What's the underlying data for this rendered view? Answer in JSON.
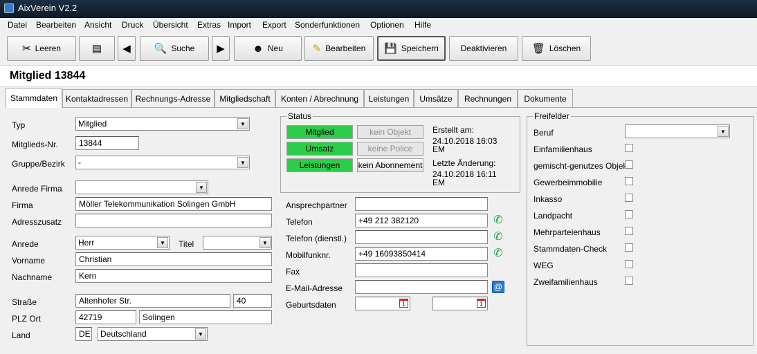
{
  "window": {
    "title": "AixVerein V2.2"
  },
  "menu": [
    "Datei",
    "Bearbeiten",
    "Ansicht",
    "Druck",
    "Übersicht",
    "Extras",
    "Import",
    "Export",
    "Sonderfunktionen",
    "Optionen",
    "Hilfe"
  ],
  "toolbar": {
    "leeren": "Leeren",
    "suche": "Suche",
    "neu": "Neu",
    "bearbeiten": "Bearbeiten",
    "speichern": "Speichern",
    "deaktivieren": "Deaktivieren",
    "loeschen": "Löschen"
  },
  "header": {
    "title": "Mitglied 13844"
  },
  "tabs": [
    "Stammdaten",
    "Kontaktadressen",
    "Rechnungs-Adresse",
    "Mitgliedschaft",
    "Konten / Abrechnung",
    "Leistungen",
    "Umsätze",
    "Rechnungen",
    "Dokumente"
  ],
  "form": {
    "typ_label": "Typ",
    "typ_value": "Mitglied",
    "nr_label": "Mitglieds-Nr.",
    "nr_value": "13844",
    "gruppe_label": "Gruppe/Bezirk",
    "gruppe_value": "-",
    "anrede_firma_label": "Anrede Firma",
    "anrede_firma_value": "",
    "firma_label": "Firma",
    "firma_value": "Möller Telekommunikation Solingen GmbH",
    "adresszusatz_label": "Adresszusatz",
    "adresszusatz_value": "",
    "anrede_label": "Anrede",
    "anrede_value": "Herr",
    "titel_label": "Titel",
    "titel_value": "",
    "vorname_label": "Vorname",
    "vorname_value": "Christian",
    "nachname_label": "Nachname",
    "nachname_value": "Kern",
    "strasse_label": "Straße",
    "strasse_value": "Altenhofer Str.",
    "hausnr_value": "40",
    "plz_label": "PLZ Ort",
    "plz_value": "42719",
    "ort_value": "Solingen",
    "land_label": "Land",
    "land_code": "DE",
    "land_value": "Deutschland"
  },
  "status": {
    "title": "Status",
    "btn_mitglied": "Mitglied",
    "btn_umsatz": "Umsatz",
    "btn_leistungen": "Leistungen",
    "btn_kein_objekt": "kein Objekt",
    "btn_keine_police": "keine Police",
    "btn_kein_abo": "kein Abonnement",
    "erstellt_label": "Erstellt am:",
    "erstellt_line1": "24.10.2018 16:03",
    "erstellt_line2": "EM",
    "aenderung_label": "Letzte Änderung:",
    "aenderung_line1": "24.10.2018 16:11",
    "aenderung_line2": "EM"
  },
  "contact": {
    "ansprechpartner_label": "Ansprechpartner",
    "ansprechpartner_value": "",
    "telefon_label": "Telefon",
    "telefon_value": "+49 212 382120",
    "telefon_d_label": "Telefon (dienstl.)",
    "telefon_d_value": "",
    "mobil_label": "Mobilfunknr.",
    "mobil_value": "+49 16093850414",
    "fax_label": "Fax",
    "fax_value": "",
    "email_label": "E-Mail-Adresse",
    "email_value": "",
    "geburt_label": "Geburtsdaten"
  },
  "freifelder": {
    "title": "Freifelder",
    "beruf_label": "Beruf",
    "items": [
      "Einfamilienhaus",
      "gemischt-genutzes Objekt",
      "Gewerbeimmobilie",
      "Inkasso",
      "Landpacht",
      "Mehrparteienhaus",
      "Stammdaten-Check",
      "WEG",
      "Zweifamilienhaus"
    ]
  }
}
